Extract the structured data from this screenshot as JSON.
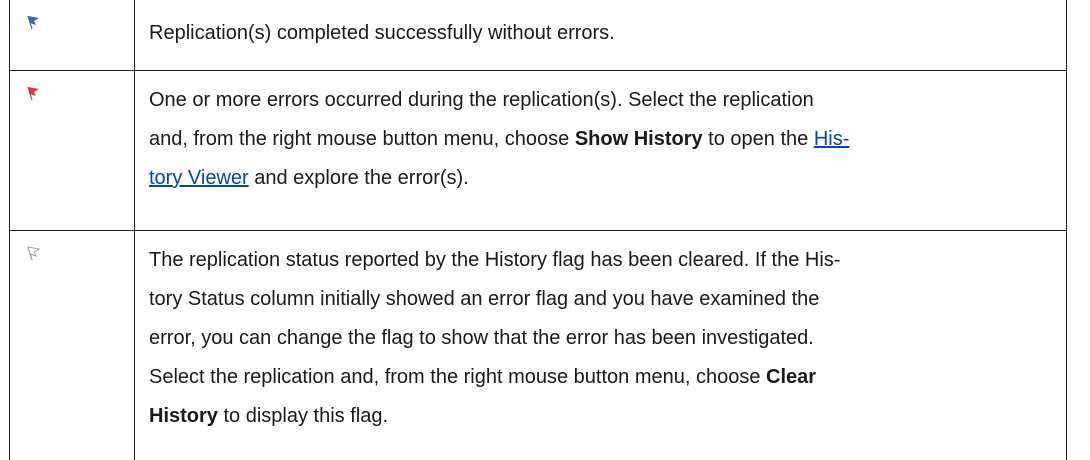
{
  "rows": [
    {
      "icon": "flag-blue-icon",
      "parts": {
        "t1": "Replication(s) completed successfully without errors."
      }
    },
    {
      "icon": "flag-red-icon",
      "line1": "One or more errors occurred during the replication(s). Select the replication",
      "line2_a": "and, from the right mouse button menu, choose ",
      "line2_bold": "Show History",
      "line2_b": " to open the ",
      "line2_link": "His-",
      "line3_link": "tory Viewer",
      "line3_b": " and explore the error(s)."
    },
    {
      "icon": "flag-cleared-icon",
      "line1": "The replication status reported by the History flag has been cleared. If the His-",
      "line2": "tory Status column initially showed an error flag and you have examined the",
      "line3": "error, you can change the flag to show that the error has been investigated.",
      "line4_a": "Select the replication and, from the right mouse button menu, choose ",
      "line4_bold": "Clear",
      "line5_bold": "History",
      "line5_b": " to display this flag."
    }
  ],
  "colors": {
    "blue_flag": "#3a63b8",
    "red_flag": "#d23a4a",
    "cleared_flag": "#9aa0a8",
    "link": "#0645ad"
  }
}
